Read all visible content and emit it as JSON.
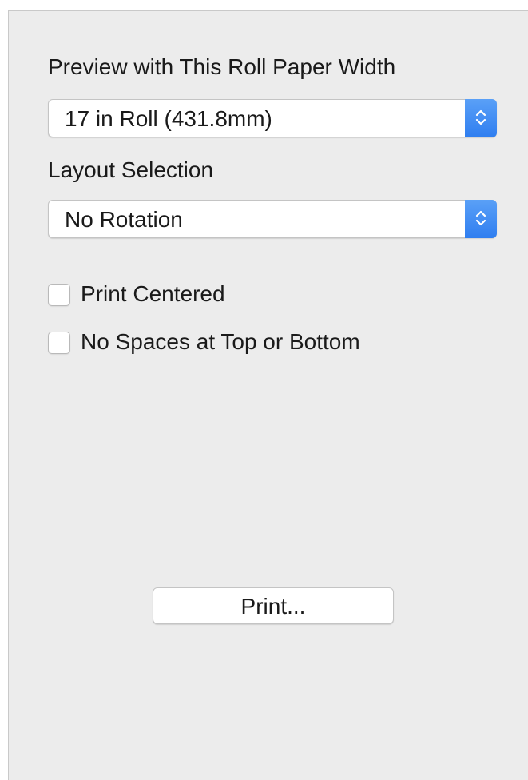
{
  "roll_paper": {
    "label": "Preview with This Roll Paper Width",
    "selected": "17 in Roll (431.8mm)",
    "icon": "updown-arrows-icon"
  },
  "layout": {
    "label": "Layout Selection",
    "selected": "No Rotation",
    "icon": "updown-arrows-icon"
  },
  "options": {
    "print_centered": {
      "label": "Print Centered",
      "checked": false
    },
    "no_spaces": {
      "label": "No Spaces at Top or Bottom",
      "checked": false
    }
  },
  "actions": {
    "print_label": "Print..."
  },
  "colors": {
    "panel_bg": "#ececec",
    "accent": "#2f7ef0"
  }
}
